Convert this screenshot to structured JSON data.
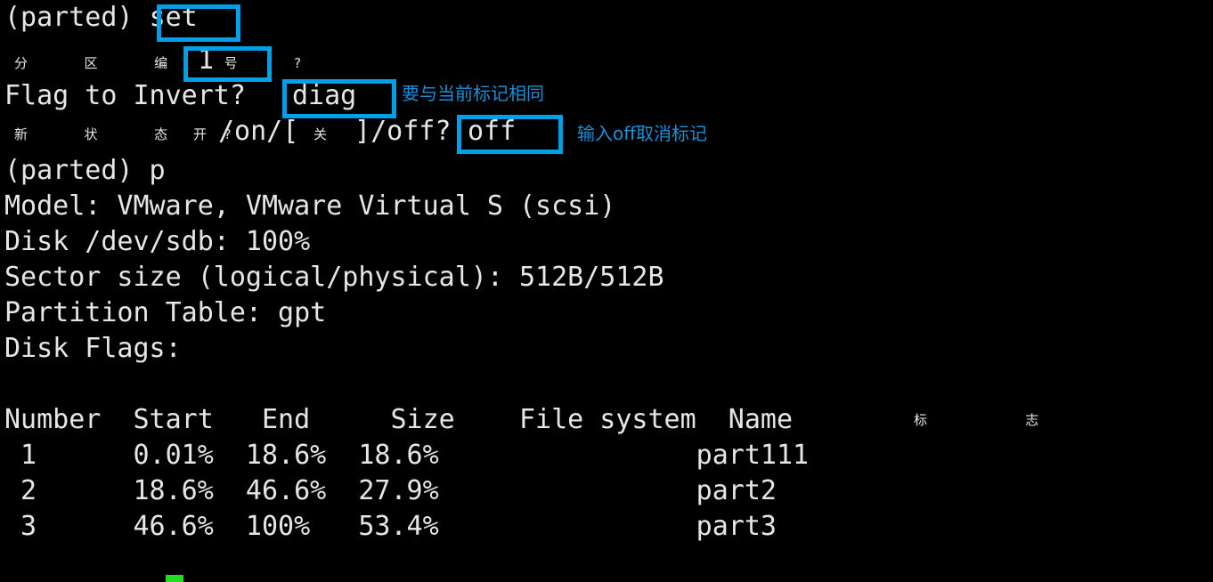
{
  "terminal": {
    "background_color": "#000000",
    "text_color": "#e6e6e6",
    "highlight_color": "#00a0e9",
    "annotation_text_color": "#1f8fd6",
    "cursor_color": "#22dd22",
    "lines": {
      "l1_prompt": "(parted) ",
      "l1_command": "set",
      "l2_label_cjk": "分  区  编  号  ?",
      "l2_value": "1",
      "l3_label": "Flag to Invert? ",
      "l3_value": "diag",
      "l4_label_cjk": "新  状  态  ?",
      "l4_on_cjk": "开",
      "l4_mid_a": "/on/[ ",
      "l4_off_cjk": "关",
      "l4_mid_b": " ]/off? ",
      "l4_value": "off",
      "l5": "(parted) p",
      "l6": "Model: VMware, VMware Virtual S (scsi)",
      "l7": "Disk /dev/sdb: 100%",
      "l8": "Sector size (logical/physical): 512B/512B",
      "l9": "Partition Table: gpt",
      "l10": "Disk Flags:"
    },
    "annotations": [
      {
        "id": "note-flag",
        "text": "要与当前标记相同"
      },
      {
        "id": "note-off",
        "text": "输入off取消标记"
      }
    ],
    "annotation_notes": {
      "flag_note": "要与当前标记相同",
      "off_note": "输入off取消标记"
    }
  },
  "partition_table": {
    "headers": {
      "number": "Number",
      "start": "Start",
      "end": "End",
      "size": "Size",
      "filesystem": "File system",
      "name": "Name",
      "flags_cjk": "标   志"
    },
    "header_row_text": "Number  Start   End     Size    File system  Name",
    "rows": [
      {
        "number": "1",
        "start": "0.01%",
        "end": "18.6%",
        "size": "18.6%",
        "filesystem": "",
        "name": "part111",
        "flags": "",
        "row_text": " 1      0.01%  18.6%  18.6%                part111"
      },
      {
        "number": "2",
        "start": "18.6%",
        "end": "46.6%",
        "size": "27.9%",
        "filesystem": "",
        "name": "part2",
        "flags": "",
        "row_text": " 2      18.6%  46.6%  27.9%                part2"
      },
      {
        "number": "3",
        "start": "46.6%",
        "end": "100%",
        "size": "53.4%",
        "filesystem": "",
        "name": "part3",
        "flags": "",
        "row_text": " 3      46.6%  100%   53.4%                part3"
      }
    ]
  }
}
